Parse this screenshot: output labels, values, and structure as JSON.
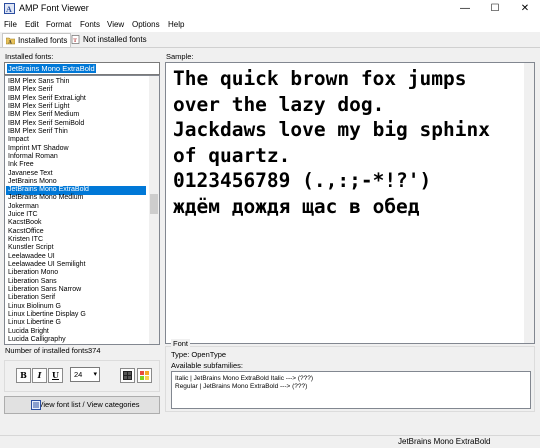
{
  "window": {
    "title": "AMP Font Viewer",
    "minimize": "—",
    "maximize": "☐",
    "close": "✕"
  },
  "menu": [
    "File",
    "Edit",
    "Format",
    "Fonts",
    "View",
    "Options",
    "Help"
  ],
  "tabs": {
    "installed": "Installed fonts",
    "not_installed": "Not installed fonts"
  },
  "left": {
    "installed_label": "Installed fonts:",
    "search_value": "JetBrains Mono ExtraBold",
    "fonts": [
      "IBM Plex Sans Thin",
      "IBM Plex Serif",
      "IBM Plex Serif ExtraLight",
      "IBM Plex Serif Light",
      "IBM Plex Serif Medium",
      "IBM Plex Serif SemiBold",
      "IBM Plex Serif Thin",
      "Impact",
      "Imprint MT Shadow",
      "Informal Roman",
      "Ink Free",
      "Javanese Text",
      "JetBrains Mono",
      "JetBrains Mono ExtraBold",
      "JetBrains Mono Medium",
      "Jokerman",
      "Juice ITC",
      "KacstBook",
      "KacstOffice",
      "Kristen ITC",
      "Kunstler Script",
      "Leelawadee UI",
      "Leelawadee UI Semilight",
      "Liberation Mono",
      "Liberation Sans",
      "Liberation Sans Narrow",
      "Liberation Serif",
      "Linux Biolinum G",
      "Linux Libertine Display G",
      "Linux Libertine G",
      "Lucida Bright",
      "Lucida Calligraphy"
    ],
    "selected_index": 13,
    "count_label": "Number of installed fonts:",
    "count_value": "374",
    "bold": "B",
    "italic": "I",
    "underline": "U",
    "font_size": "24",
    "size_arrow": "▾",
    "view_button": "View font list / View categories"
  },
  "sample": {
    "label": "Sample:",
    "lines": [
      "The quick brown fox jumps",
      "over the lazy dog.",
      "Jackdaws love my big sphinx",
      "of quartz.",
      "0123456789 (.,:;-*!?')",
      "ждём дождя щас в обед"
    ]
  },
  "font_info": {
    "section": "Font",
    "type": "Type:  OpenType",
    "subfamilies_label": "Available subfamilies:",
    "subfamilies": [
      "Italic   |   JetBrains Mono ExtraBold Italic   --->   (???)",
      "Regular  |   JetBrains Mono ExtraBold   --->   (???)"
    ]
  },
  "status": "JetBrains Mono ExtraBold",
  "colors": {
    "selection": "#0078d7",
    "window_bg": "#f0f0f0"
  }
}
